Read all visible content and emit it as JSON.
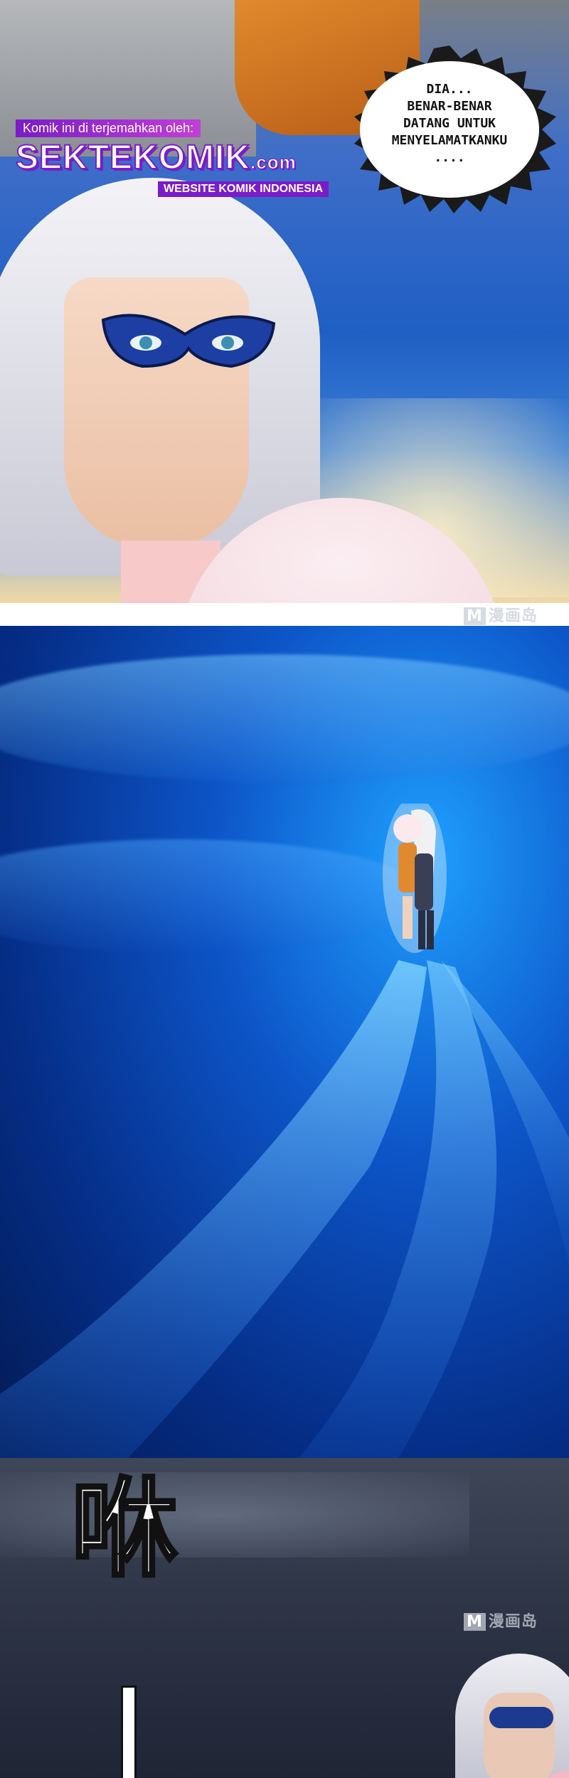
{
  "scanlator": {
    "credit": "Komik ini di terjemahkan oleh:",
    "logo": "SEKTEKOMIK",
    "logo_domain": ".com",
    "subtitle": "WEBSITE KOMIK INDONESIA"
  },
  "panel1": {
    "speech": "DIA...\nBENAR-BENAR\nDATANG UNTUK\nMENYELAMATKANKU\n...."
  },
  "watermark": {
    "badge": "M",
    "text": "漫画岛"
  },
  "panel3": {
    "sfx": "咻"
  },
  "colors": {
    "scanlator_purple": "#7a1cc7",
    "ocean_blue": "#0d55c8",
    "night_slate": "#2e3547"
  }
}
